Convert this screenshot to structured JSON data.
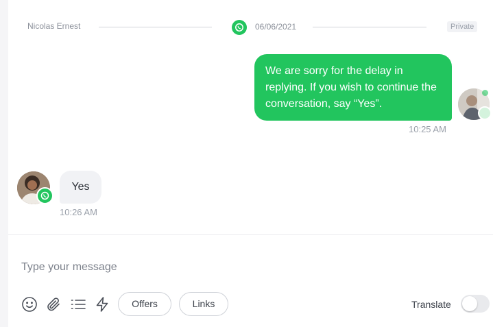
{
  "header": {
    "agent_name": "Nicolas Ernest",
    "date": "06/06/2021",
    "private_label": "Private",
    "channel_icon": "whatsapp-icon"
  },
  "messages": [
    {
      "direction": "outgoing",
      "text": "We are sorry for the delay in replying. If you wish to continue the conversation, say “Yes”.",
      "time": "10:25 AM"
    },
    {
      "direction": "incoming",
      "text": "Yes",
      "time": "10:26 AM",
      "channel_icon": "whatsapp-icon"
    }
  ],
  "composer": {
    "placeholder": "Type your message",
    "tools": [
      "emoji-icon",
      "attachment-icon",
      "list-icon",
      "lightning-icon"
    ],
    "offers_label": "Offers",
    "links_label": "Links",
    "translate_label": "Translate",
    "translate_enabled": false
  },
  "colors": {
    "accent": "#22c55e",
    "incoming_bubble": "#f1f2f5"
  }
}
